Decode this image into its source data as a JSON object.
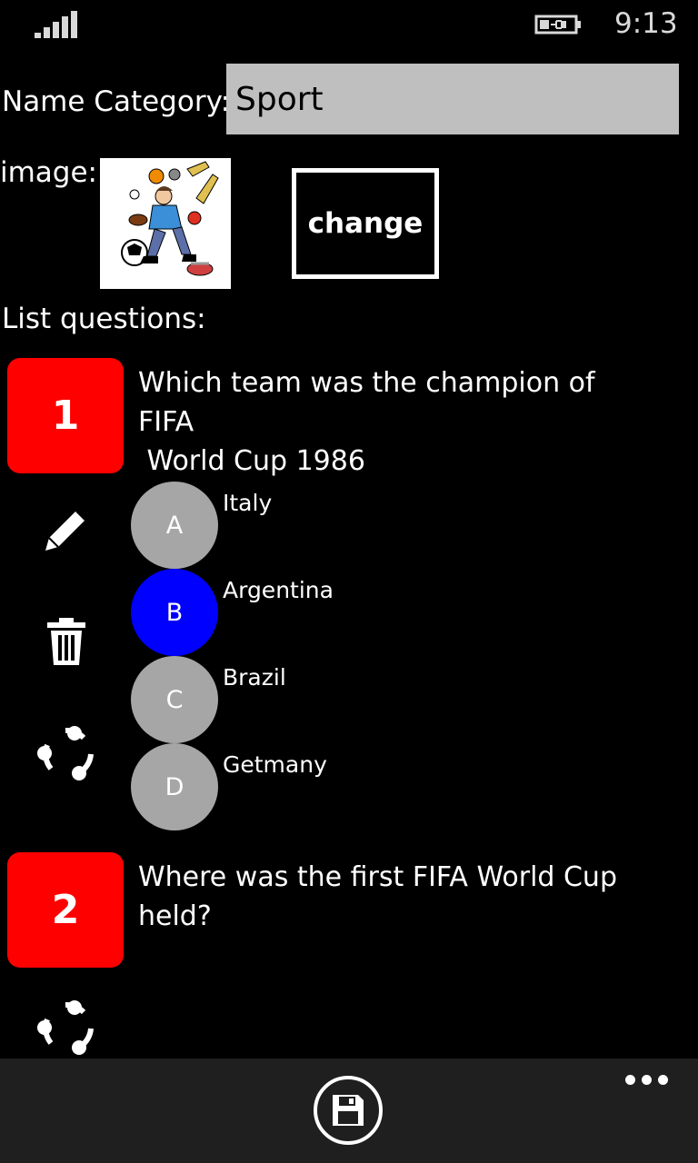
{
  "status": {
    "time": "9:13"
  },
  "form": {
    "name_label": "Name Category:",
    "name_value": "Sport",
    "image_label": "image:",
    "change_label": "change",
    "list_label": "List questions:"
  },
  "questions": [
    {
      "number": "1",
      "text": "Which team was the champion of FIFA\n World Cup 1986",
      "options": [
        {
          "letter": "A",
          "text": "Italy",
          "selected": false
        },
        {
          "letter": "B",
          "text": "Argentina",
          "selected": true
        },
        {
          "letter": "C",
          "text": "Brazil",
          "selected": false
        },
        {
          "letter": "D",
          "text": "Getmany",
          "selected": false
        }
      ]
    },
    {
      "number": "2",
      "text": "Where was the first FIFA World Cup\nheld?"
    }
  ],
  "colors": {
    "question_badge": "#ff0000",
    "option_default": "#a6a6a6",
    "option_selected": "#0000ff",
    "input_bg": "#bfbfbf",
    "appbar_bg": "#1f1f1f"
  },
  "icons": {
    "edit": "pencil-icon",
    "delete": "trash-icon",
    "share": "share-icon",
    "save": "save-icon",
    "more": "more-icon"
  }
}
